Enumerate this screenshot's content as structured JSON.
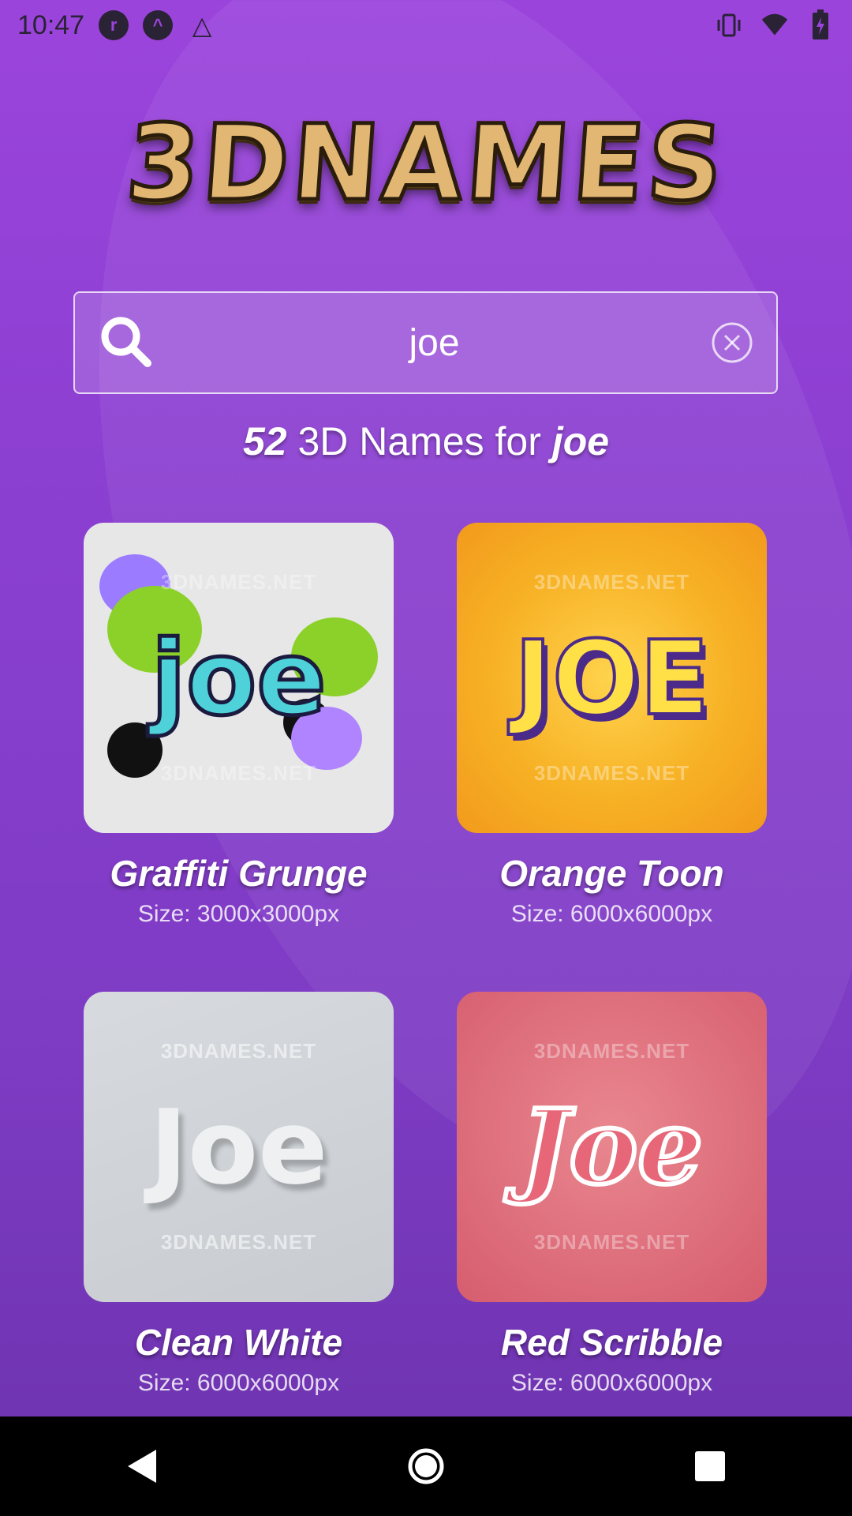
{
  "status_bar": {
    "time": "10:47",
    "left_icons": [
      "notification-app-icon",
      "arrow-up-circle-icon",
      "triangle-outline-icon"
    ],
    "right_icons": [
      "vibrate-icon",
      "wifi-icon",
      "battery-charging-icon"
    ]
  },
  "logo": {
    "text": "3DNAMES"
  },
  "search": {
    "value": "joe",
    "placeholder": "",
    "icon": "search-icon",
    "clear_icon": "clear-icon"
  },
  "results": {
    "count": "52",
    "middle": "3D Names for",
    "query": "joe"
  },
  "watermark": "3DNAMES.NET",
  "cards": [
    {
      "word": "joe",
      "title": "Graffiti Grunge",
      "size": "Size: 3000x3000px"
    },
    {
      "word": "JOE",
      "title": "Orange Toon",
      "size": "Size: 6000x6000px"
    },
    {
      "word": "Joe",
      "title": "Clean White",
      "size": "Size: 6000x6000px"
    },
    {
      "word": "Joe",
      "title": "Red Scribble",
      "size": "Size: 6000x6000px"
    }
  ],
  "nav": {
    "icons": [
      "back-icon",
      "home-icon",
      "recents-icon"
    ]
  },
  "colors": {
    "background": "#9b44dc",
    "accent_gold": "#e2b774",
    "text": "#ffffff"
  }
}
